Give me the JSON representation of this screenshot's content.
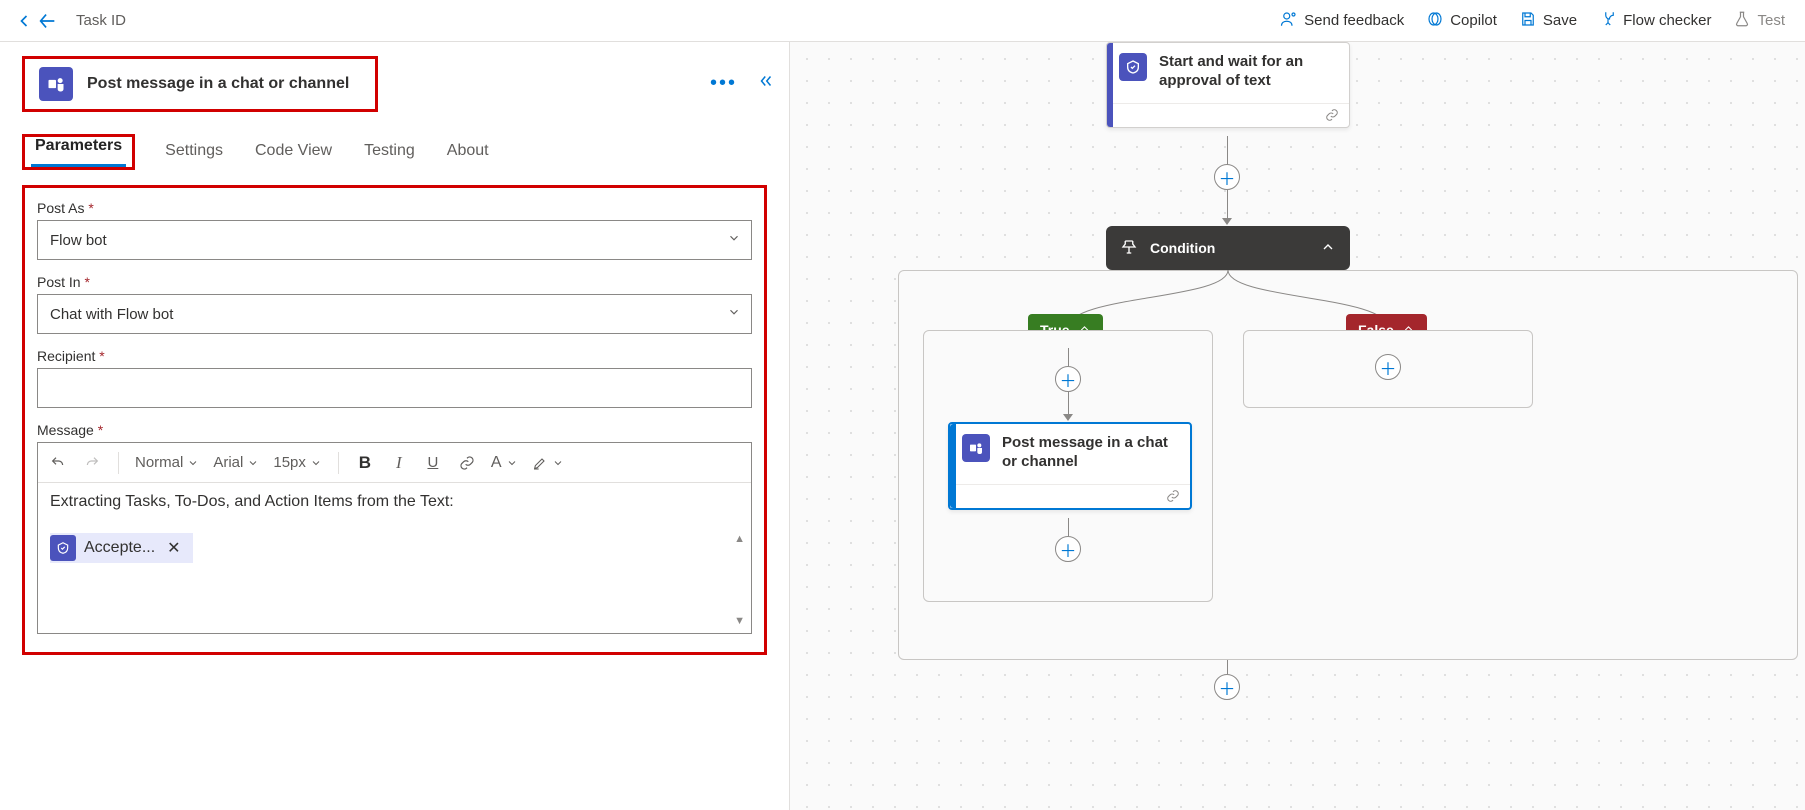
{
  "topbar": {
    "breadcrumb": "Task ID",
    "actions": {
      "feedback": "Send feedback",
      "copilot": "Copilot",
      "save": "Save",
      "flow_checker": "Flow checker",
      "test": "Test"
    }
  },
  "action_card": {
    "title": "Post message in a chat or channel"
  },
  "tabs": {
    "parameters": "Parameters",
    "settings": "Settings",
    "code_view": "Code View",
    "testing": "Testing",
    "about": "About"
  },
  "params": {
    "post_as_label": "Post As",
    "post_as_value": "Flow bot",
    "post_in_label": "Post In",
    "post_in_value": "Chat with Flow bot",
    "recipient_label": "Recipient",
    "recipient_value": "",
    "message_label": "Message",
    "rte_toolbar": {
      "style": "Normal",
      "font": "Arial",
      "size": "15px"
    },
    "message_text": "Extracting Tasks, To-Dos, and Action Items from the Text:",
    "token_label": "Accepte..."
  },
  "canvas": {
    "approval_title": "Start and wait for an approval of text",
    "condition_label": "Condition",
    "true_label": "True",
    "false_label": "False",
    "post_card_title": "Post message in a chat or channel"
  }
}
